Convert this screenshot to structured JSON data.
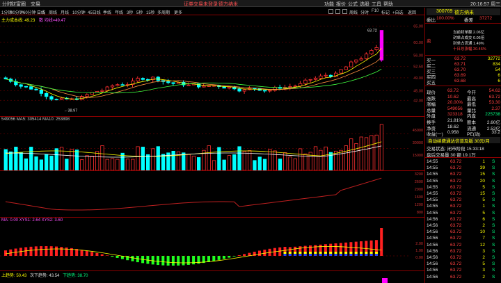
{
  "menu": {
    "items": [
      "分时",
      "财富圈",
      "交易"
    ],
    "center_links": [
      "证券交易未登录",
      "德方纳米"
    ],
    "right_items": [
      "功能",
      "报价",
      "公式",
      "选股",
      "工具",
      "帮助"
    ],
    "icons": [
      "window-icon",
      "window-icon",
      "window-icon",
      "window-icon",
      "window-icon",
      "window-icon",
      "window-icon",
      "window-icon",
      "window-icon"
    ],
    "right_labels": [
      "周线",
      "分时",
      "F10",
      "标记",
      "+自选",
      "返回"
    ],
    "clock": "20:16:57 周三"
  },
  "periods": {
    "items": [
      "1分钟",
      "30分钟",
      "60分钟",
      "日线",
      "周线",
      "月线",
      "10分钟",
      "45日线",
      "季线",
      "年线",
      "3秒",
      "5秒",
      "15秒",
      "多周期",
      "更多"
    ],
    "active_index": 3
  },
  "main_chart": {
    "indicator_line": "主力成本线: 49.23",
    "indicator_line2": "数 均线=49.47",
    "y_labels": [
      "65.00",
      "60.00",
      "56.00",
      "52.50",
      "49.00",
      "45.00",
      "42.00"
    ],
    "high_label": "63.72",
    "low_label": "38.97",
    "vol_header": "549056  MA5: 305414  MA10: 253898",
    "vol_labels": [
      "45000",
      "30000",
      "15000"
    ],
    "curve_labels": [
      "3200",
      "2600",
      "2000",
      "1600",
      "1200",
      "800"
    ],
    "macd_header": "MA: 0.00  XYS1: 2.64  XYS2: 3.60",
    "macd_labels": [
      "2.00",
      "1.00",
      "0.00"
    ],
    "bottom_header_left": "上趋势: 50.43",
    "bottom_header_mid": "次下趋势: 43.54",
    "bottom_header_right": "下趋势: 38.70"
  },
  "sidebar": {
    "code": "300769",
    "name": "德方纳米",
    "wb_label": "委比",
    "wb_value": "100.00%",
    "wc_label": "委差",
    "wc_value": "37272",
    "stats": [
      "当前封单额 2.06亿",
      "封单占成交 0.06倍",
      "封单占流通 1.49%",
      "十日总涨幅 30.46%"
    ],
    "sell_label": "卖",
    "buy_rows": [
      {
        "label": "买一",
        "price": "63.72",
        "vol": "32772"
      },
      {
        "label": "买二",
        "price": "63.71",
        "vol": "834"
      },
      {
        "label": "买三",
        "price": "63.70",
        "vol": "54"
      },
      {
        "label": "买四",
        "price": "63.69",
        "vol": "6"
      },
      {
        "label": "买五",
        "price": "63.68",
        "vol": "6"
      }
    ],
    "quote_rows": [
      {
        "k1": "现价",
        "v1": "63.72",
        "k2": "今开",
        "v2": "54.62"
      },
      {
        "k1": "涨跌",
        "v1": "10.62",
        "k2": "最高",
        "v2": "63.72"
      },
      {
        "k1": "涨幅",
        "v1": "20.00%",
        "k2": "最低",
        "v2": "53.30"
      },
      {
        "k1": "总量",
        "v1": "549056",
        "k2": "量比",
        "v2": "2.37"
      },
      {
        "k1": "外盘",
        "v1": "323318",
        "k2": "内盘",
        "v2": "225738"
      },
      {
        "k1": "换手",
        "v1": "21.81%",
        "k2": "股本",
        "v2": "2.60亿"
      },
      {
        "k1": "净资",
        "v1": "18.62",
        "k2": "流通",
        "v2": "2.52亿"
      },
      {
        "k1": "收益(一)",
        "v1": "0.958",
        "k2": "PE(动)",
        "v2": "33.2"
      }
    ],
    "promo": "自动续费通达信普及版 30元/月",
    "trade_status": "交易状态: 闭市阶段 15:33:18",
    "last_trade": "盘后交易量 30 额 19.1万",
    "ticks": [
      {
        "t": "14:55",
        "p": "63.72",
        "v": "1",
        "bs": "S"
      },
      {
        "t": "14:55",
        "p": "63.72",
        "v": "39",
        "bs": "S"
      },
      {
        "t": "14:55",
        "p": "63.72",
        "v": "15",
        "bs": "S"
      },
      {
        "t": "14:55",
        "p": "63.72",
        "v": "20",
        "bs": "S"
      },
      {
        "t": "14:55",
        "p": "63.72",
        "v": "5",
        "bs": "S"
      },
      {
        "t": "14:55",
        "p": "63.72",
        "v": "15",
        "bs": "S"
      },
      {
        "t": "14:55",
        "p": "63.72",
        "v": "5",
        "bs": "S"
      },
      {
        "t": "14:55",
        "p": "63.72",
        "v": "1",
        "bs": "S"
      },
      {
        "t": "14:55",
        "p": "63.72",
        "v": "5",
        "bs": "S"
      },
      {
        "t": "14:56",
        "p": "63.72",
        "v": "6",
        "bs": "S"
      },
      {
        "t": "14:56",
        "p": "63.72",
        "v": "2",
        "bs": "S"
      },
      {
        "t": "14:56",
        "p": "63.72",
        "v": "10",
        "bs": "S"
      },
      {
        "t": "14:56",
        "p": "63.72",
        "v": "7",
        "bs": "S"
      },
      {
        "t": "14:56",
        "p": "63.72",
        "v": "12",
        "bs": "S"
      },
      {
        "t": "14:56",
        "p": "63.72",
        "v": "3",
        "bs": "S"
      },
      {
        "t": "14:56",
        "p": "63.72",
        "v": "2",
        "bs": "S"
      },
      {
        "t": "14:56",
        "p": "63.72",
        "v": "5",
        "bs": "S"
      },
      {
        "t": "14:56",
        "p": "63.72",
        "v": "3",
        "bs": "S"
      },
      {
        "t": "14:56",
        "p": "63.72",
        "v": "2",
        "bs": "S"
      }
    ]
  },
  "colors": {
    "up": "#ff3030",
    "down": "#00ffff",
    "accent": "#8b0000",
    "ma": "#ffff00"
  }
}
